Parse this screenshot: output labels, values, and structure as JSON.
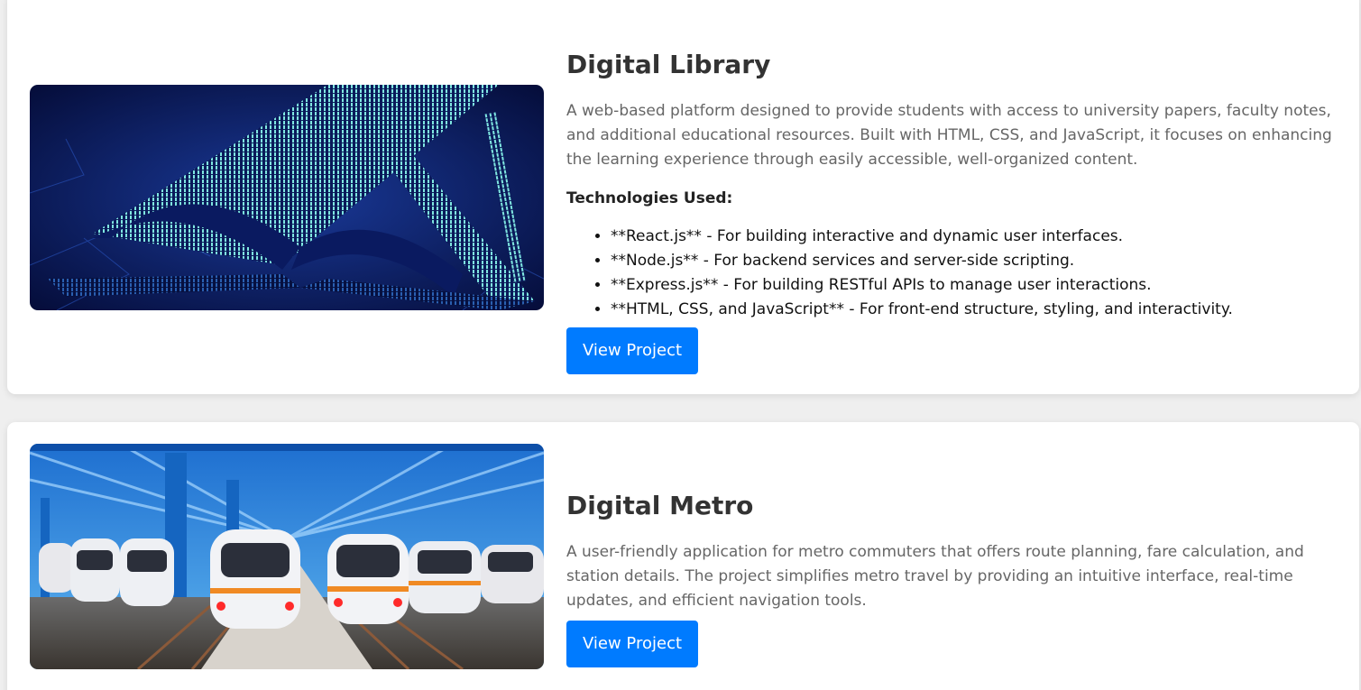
{
  "projects": [
    {
      "title": "Digital Library",
      "description": "A web-based platform designed to provide students with access to university papers, faculty notes, and additional educational resources. Built with HTML, CSS, and JavaScript, it focuses on enhancing the learning experience through easily accessible, well-organized content.",
      "tech_heading": "Technologies Used:",
      "technologies": [
        "**React.js** - For building interactive and dynamic user interfaces.",
        "**Node.js** - For backend services and server-side scripting.",
        "**Express.js** - For building RESTful APIs to manage user interactions.",
        "**HTML, CSS, and JavaScript** - For front-end structure, styling, and interactivity."
      ],
      "button_label": "View Project",
      "image_icon": "open-book-digital-image"
    },
    {
      "title": "Digital Metro",
      "description": "A user-friendly application for metro commuters that offers route planning, fare calculation, and station details. The project simplifies metro travel by providing an intuitive interface, real-time updates, and efficient navigation tools.",
      "button_label": "View Project",
      "image_icon": "metro-depot-trains-image"
    }
  ],
  "colors": {
    "button": "#007bff",
    "page_background": "#efefef",
    "card_background": "#ffffff"
  }
}
